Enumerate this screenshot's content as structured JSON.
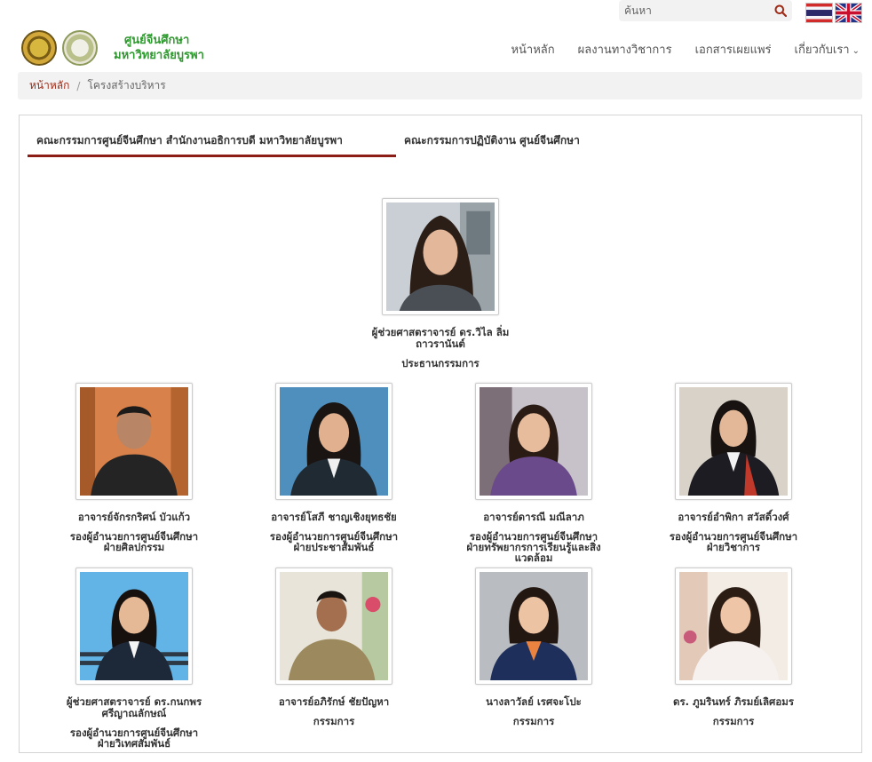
{
  "search": {
    "placeholder": "ค้นหา"
  },
  "logo": {
    "line1": "ศูนย์จีนศึกษา",
    "line2": "มหาวิทยาลัยบูรพา"
  },
  "nav": {
    "items": [
      "หน้าหลัก",
      "ผลงานทางวิชาการ",
      "เอกสารเผยแพร่",
      "เกี่ยวกับเรา"
    ]
  },
  "breadcrumb": {
    "home": "หน้าหลัก",
    "current": "โครงสร้างบริหาร"
  },
  "tabs": [
    "คณะกรรมการศูนย์จีนศึกษา สำนักงานอธิการบดี มหาวิทยาลัยบูรพา",
    "คณะกรรมการปฏิบัติงาน ศูนย์จีนศึกษา"
  ],
  "chair": {
    "name_l1": "ผู้ช่วยศาสตราจารย์ ดร.วิไล ลิ่ม",
    "name_l2": "ถาวรานันต์",
    "role": "ประธานกรรมการ"
  },
  "members": [
    {
      "name": "อาจารย์จักรกริศน์ บัวแก้ว",
      "role_l1": "รองผู้อำนวยการศูนย์จีนศึกษา",
      "role_l2": "ฝ่ายศิลปกรรม",
      "role_l3": ""
    },
    {
      "name": "อาจารย์โสภี ชาญเชิงยุทธชัย",
      "role_l1": "รองผู้อำนวยการศูนย์จีนศึกษา",
      "role_l2": "ฝ่ายประชาสัมพันธ์",
      "role_l3": ""
    },
    {
      "name": "อาจารย์ดารณี มณีลาภ",
      "role_l1": "รองผู้อำนวยการศูนย์จีนศึกษา",
      "role_l2": "ฝ่ายทรัพยากรการเรียนรู้และสิ่ง",
      "role_l3": "แวดล้อม"
    },
    {
      "name": "อาจารย์อำพิกา สวัสดิ์วงศ์",
      "role_l1": "รองผู้อำนวยการศูนย์จีนศึกษา",
      "role_l2": "ฝ่ายวิชาการ",
      "role_l3": ""
    },
    {
      "name_l1": "ผู้ช่วยศาสตราจารย์ ดร.กนกพร",
      "name_l2": "ศรีญาณลักษณ์",
      "role_l1": "รองผู้อำนวยการศูนย์จีนศึกษา",
      "role_l2": "ฝ่ายวิเทศสัมพันธ์"
    },
    {
      "name": "อาจารย์อภิรักษ์ ชัยปัญหา",
      "role_l1": "กรรมการ"
    },
    {
      "name": "นางลาวัลย์ เรศจะโปะ",
      "role_l1": "กรรมการ"
    },
    {
      "name": "ดร. ภูมรินทร์ ภิรมย์เลิศอมร",
      "role_l1": "กรรมการ"
    }
  ],
  "colors": {
    "accent": "#8b1c16",
    "breadcrumb_link": "#a12a16",
    "logo_text": "#2f9a2f"
  },
  "icons": [
    "search-icon",
    "thai-flag-icon",
    "uk-flag-icon",
    "chevron-down-icon"
  ]
}
